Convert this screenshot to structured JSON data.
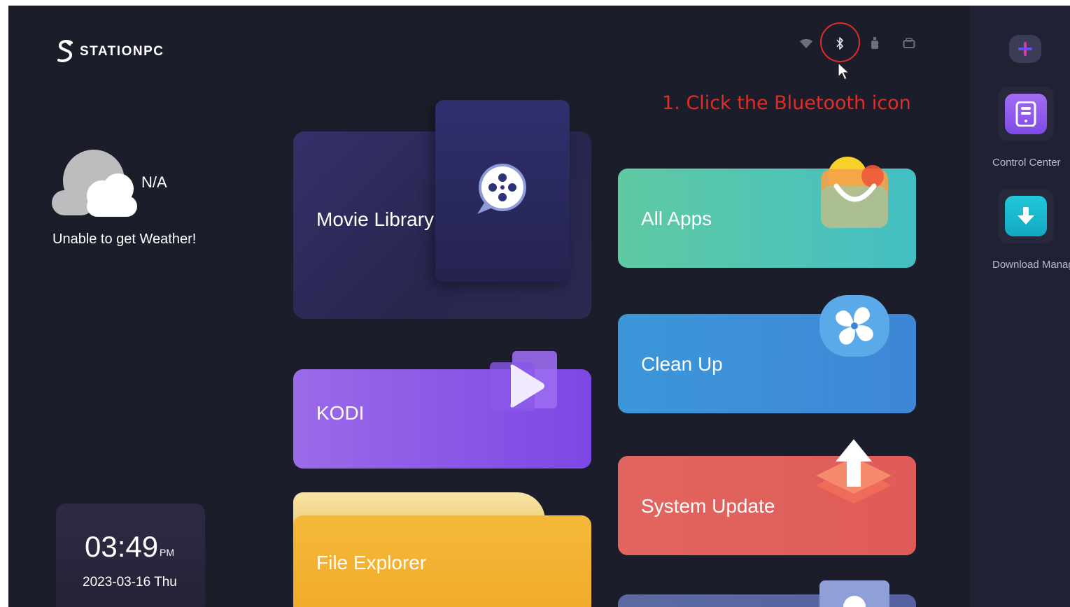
{
  "brand": {
    "logo_text": "STATIONPC"
  },
  "status_bar": {
    "icons": [
      "wifi-icon",
      "bluetooth-icon",
      "usb-icon",
      "storage-icon"
    ]
  },
  "annotation": {
    "instruction": "1. Click the Bluetooth icon",
    "color": "#e02d26"
  },
  "weather": {
    "temperature": "N/A",
    "message": "Unable to get Weather!"
  },
  "clock": {
    "time": "03:49",
    "ampm": "PM",
    "date": "2023-03-16  Thu"
  },
  "tiles": {
    "movie": "Movie Library",
    "kodi": "KODI",
    "files": "File Explorer",
    "all_apps": "All Apps",
    "clean_up": "Clean Up",
    "system_update": "System Update"
  },
  "sidebar": {
    "items": [
      {
        "label": "Control Center",
        "icon": "control-center-icon"
      },
      {
        "label": "Download Manager",
        "icon": "download-icon"
      }
    ]
  }
}
